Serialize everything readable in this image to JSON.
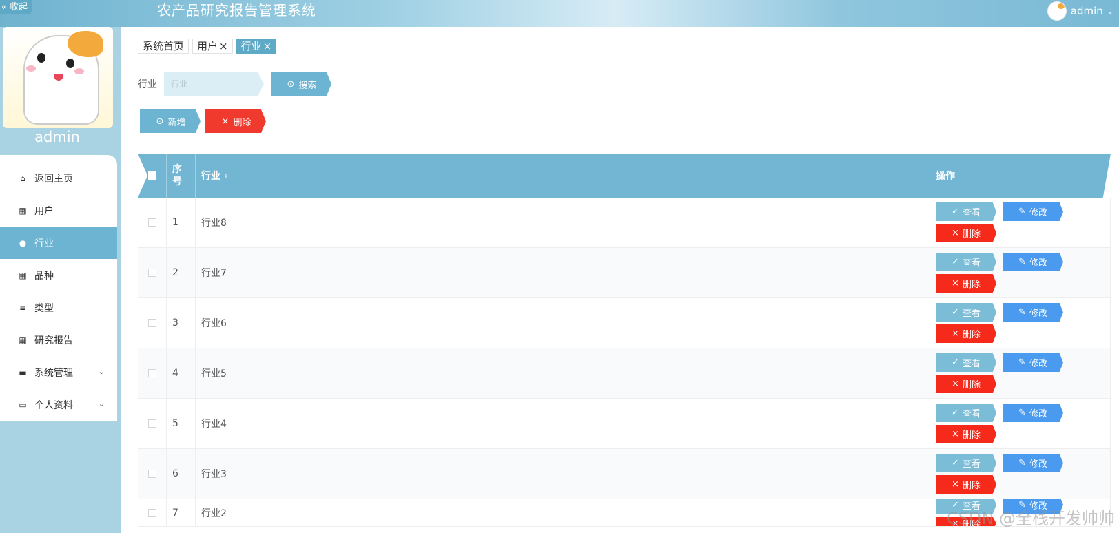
{
  "header": {
    "collapse_label": "« 收起",
    "title": "农产品研究报告管理系统",
    "user_name": "admin",
    "user_chevron": "⌄"
  },
  "sidebar": {
    "username": "admin",
    "items": [
      {
        "label": "返回主页",
        "icon": "home-icon",
        "glyph": "⌂"
      },
      {
        "label": "用户",
        "icon": "grid-icon",
        "glyph": "▦"
      },
      {
        "label": "行业",
        "icon": "user-icon",
        "glyph": "●",
        "active": true
      },
      {
        "label": "品种",
        "icon": "grid-icon",
        "glyph": "▦"
      },
      {
        "label": "类型",
        "icon": "sliders-icon",
        "glyph": "≡"
      },
      {
        "label": "研究报告",
        "icon": "grid-icon",
        "glyph": "▦"
      },
      {
        "label": "系统管理",
        "icon": "briefcase-icon",
        "glyph": "▬",
        "chevron": "⌄"
      },
      {
        "label": "个人资料",
        "icon": "card-icon",
        "glyph": "▭",
        "chevron": "⌄"
      }
    ]
  },
  "tabs": [
    {
      "label": "系统首页",
      "closable": false
    },
    {
      "label": "用户",
      "closable": true,
      "close": "×"
    },
    {
      "label": "行业",
      "closable": true,
      "close": "×",
      "active": true
    }
  ],
  "search": {
    "label": "行业",
    "placeholder": "行业",
    "value": "",
    "button_label": "搜索",
    "button_icon": "⊙"
  },
  "actions": {
    "add_label": "新增",
    "add_icon": "⊙",
    "delete_label": "删除",
    "delete_icon": "×"
  },
  "table": {
    "headers": {
      "no": "序号",
      "name": "行业",
      "op": "操作"
    },
    "sort_icon": "⇕",
    "ops": {
      "view": "查看",
      "view_icon": "✓",
      "edit": "修改",
      "edit_icon": "✎",
      "delete": "删除",
      "delete_icon": "×"
    },
    "rows": [
      {
        "no": "1",
        "name": "行业8"
      },
      {
        "no": "2",
        "name": "行业7"
      },
      {
        "no": "3",
        "name": "行业6"
      },
      {
        "no": "4",
        "name": "行业5"
      },
      {
        "no": "5",
        "name": "行业4"
      },
      {
        "no": "6",
        "name": "行业3"
      },
      {
        "no": "7",
        "name": "行业2"
      }
    ]
  },
  "watermark": "CSDN @全栈开发帅帅",
  "colors": {
    "accent": "#6cb4d2",
    "danger": "#f52a1a",
    "edit": "#4a9bef",
    "sidebar_bg": "#a9d2e3"
  }
}
